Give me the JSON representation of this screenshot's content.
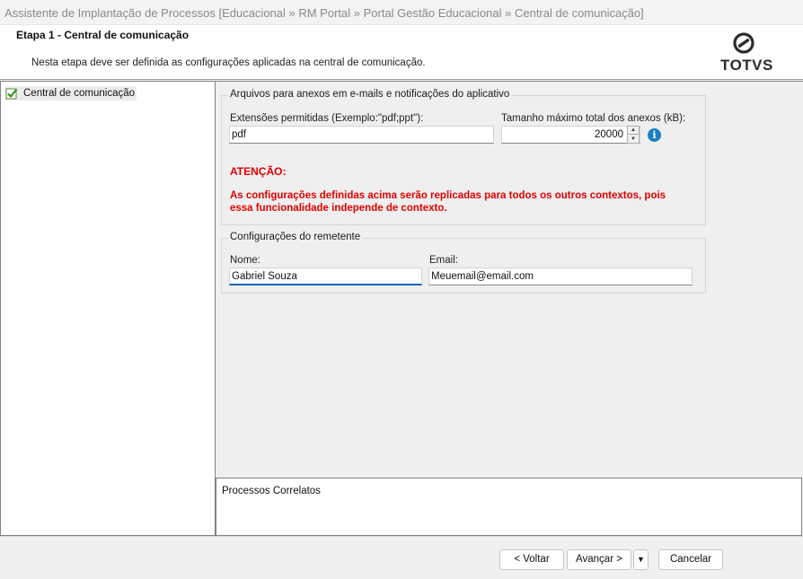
{
  "window": {
    "title": "Assistente de Implantação de Processos [Educacional » RM Portal » Portal Gestão Educacional » Central de comunicação]"
  },
  "header": {
    "step_title": "Etapa 1 - Central de comunicação",
    "description": "Nesta etapa deve ser definida as configurações aplicadas na central de comunicação.",
    "logo_text": "TOTVS"
  },
  "tree": {
    "items": [
      {
        "label": "Central de comunicação",
        "checked": true
      }
    ]
  },
  "attachments": {
    "legend": "Arquivos para anexos em e-mails e notificações do aplicativo",
    "extensions_label": "Extensões permitidas (Exemplo:\"pdf;ppt\"):",
    "extensions_value": "pdf",
    "max_size_label": "Tamanho máximo total dos anexos (kB):",
    "max_size_value": "20000",
    "info_icon": "info-icon",
    "warning_title": "ATENÇÃO:",
    "warning_line1": "As configurações definidas acima serão replicadas para todos os outros contextos, pois",
    "warning_line2": "essa funcionalidade independe de contexto.",
    "warning_color": "#e20000"
  },
  "sender": {
    "legend": "Configurações do remetente",
    "name_label": "Nome:",
    "name_value": "Gabriel Souza",
    "email_label": "Email:",
    "email_value": "Meuemail@email.com"
  },
  "related": {
    "label": "Processos Correlatos"
  },
  "footer": {
    "back_label": "< Voltar",
    "next_label": "Avançar >",
    "dropdown_glyph": "▼",
    "cancel_label": "Cancelar"
  },
  "colors": {
    "accent": "#1c64b9",
    "info": "#1e7fc0"
  }
}
